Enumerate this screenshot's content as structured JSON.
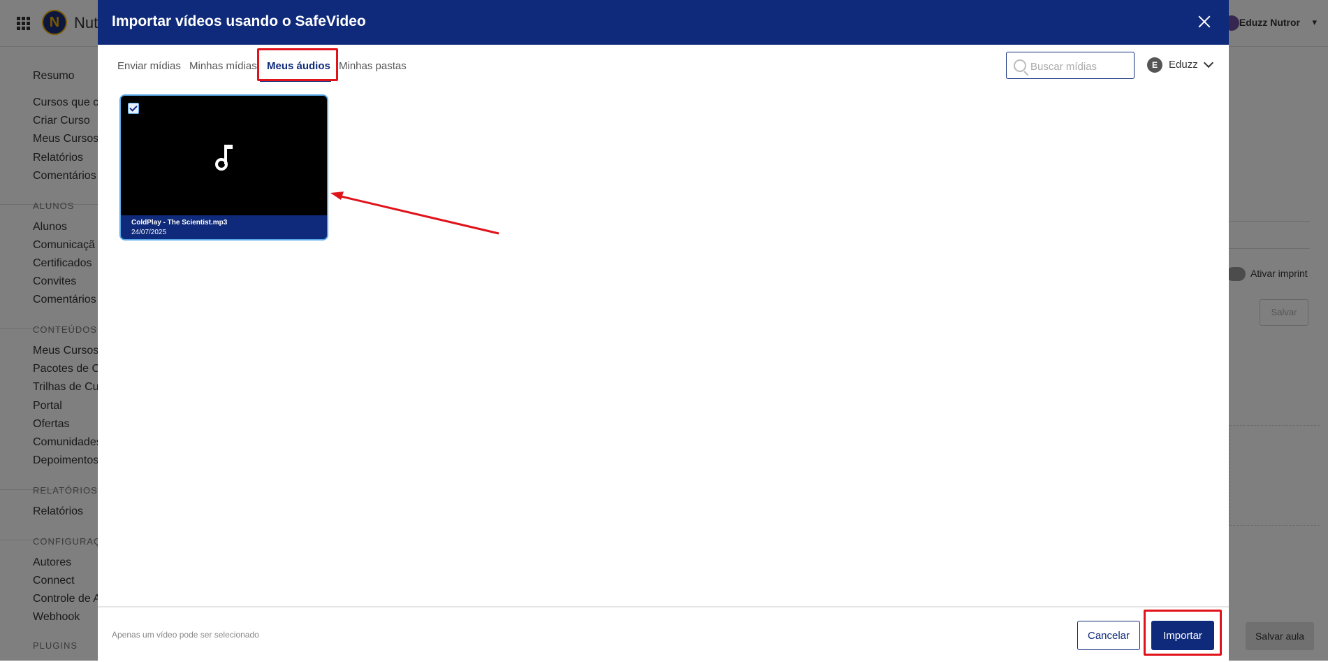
{
  "background": {
    "app_name": "Nut",
    "user_name": "Eduzz Nutror",
    "nav": [
      "Resumo",
      "Cursos que c",
      "Criar Curso",
      "Meus Cursos",
      "Relatórios",
      "Comentários",
      "Alunos",
      "Comunicaçã",
      "Certificados",
      "Convites",
      "Comentários",
      "Meus Cursos",
      "Pacotes de C",
      "Trilhas de Cu",
      "Portal",
      "Ofertas",
      "Comunidades",
      "Depoimentos",
      "Relatórios",
      "Autores",
      "Connect",
      "Controle de A",
      "Webhook"
    ],
    "sections": [
      "ALUNOS",
      "CONTEÚDOS",
      "RELATÓRIOS",
      "CONFIGURAÇ",
      "PLUGINS"
    ],
    "toggle_label": "Ativar imprint",
    "save_label": "Salvar",
    "save_lesson_label": "Salvar aula"
  },
  "modal": {
    "title": "Importar vídeos usando o SafeVideo",
    "tabs": [
      "Enviar mídias",
      "Minhas mídias",
      "Meus áudios",
      "Minhas pastas"
    ],
    "active_tab": "Meus áudios",
    "search_placeholder": "Buscar mídias",
    "account": {
      "initial": "E",
      "name": "Eduzz"
    },
    "media": [
      {
        "name": "ColdPlay - The Scientist.mp3",
        "date": "24/07/2025",
        "selected": true,
        "icon": "music-note-icon"
      }
    ],
    "footer_note": "Apenas um vídeo pode ser selecionado",
    "cancel_label": "Cancelar",
    "import_label": "Importar"
  },
  "colors": {
    "header": "#0f2a7a",
    "annotation": "#e0121a",
    "selection": "#5aa8e6"
  }
}
